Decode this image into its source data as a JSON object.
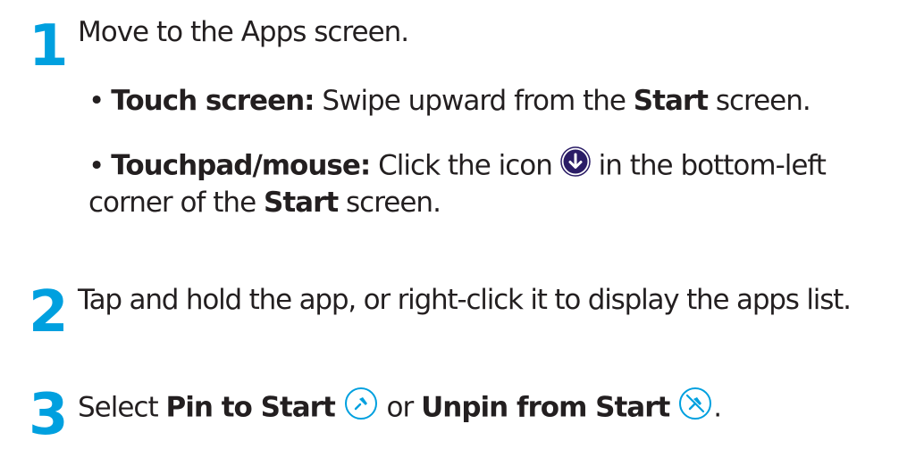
{
  "steps": [
    {
      "number": "1",
      "text": "Move to the Apps screen.",
      "bullets": [
        {
          "bullet": "•",
          "label": "Touch screen:",
          "text_before": " Swipe upward from the ",
          "bold_word": "Start",
          "text_after": " screen."
        },
        {
          "bullet": "•",
          "label": "Touchpad/mouse:",
          "text_before": " Click the icon ",
          "text_after": " in the bottom-left",
          "text_cont_1": "corner of the ",
          "bold_word": "Start",
          "text_cont_2": " screen."
        }
      ]
    },
    {
      "number": "2",
      "text": "Tap and hold the app, or right-click it to display the apps list."
    },
    {
      "number": "3",
      "text_before": "Select ",
      "pin_label": "Pin to Start",
      "text_mid": " or ",
      "unpin_label": "Unpin from Start",
      "text_after": "."
    }
  ],
  "colors": {
    "step_number": "#00a0df",
    "icon_accent": "#00a0df",
    "apps_icon_fill": "#2b1d66"
  },
  "icons": [
    "down-arrow-circle-icon",
    "pin-icon",
    "unpin-icon"
  ]
}
